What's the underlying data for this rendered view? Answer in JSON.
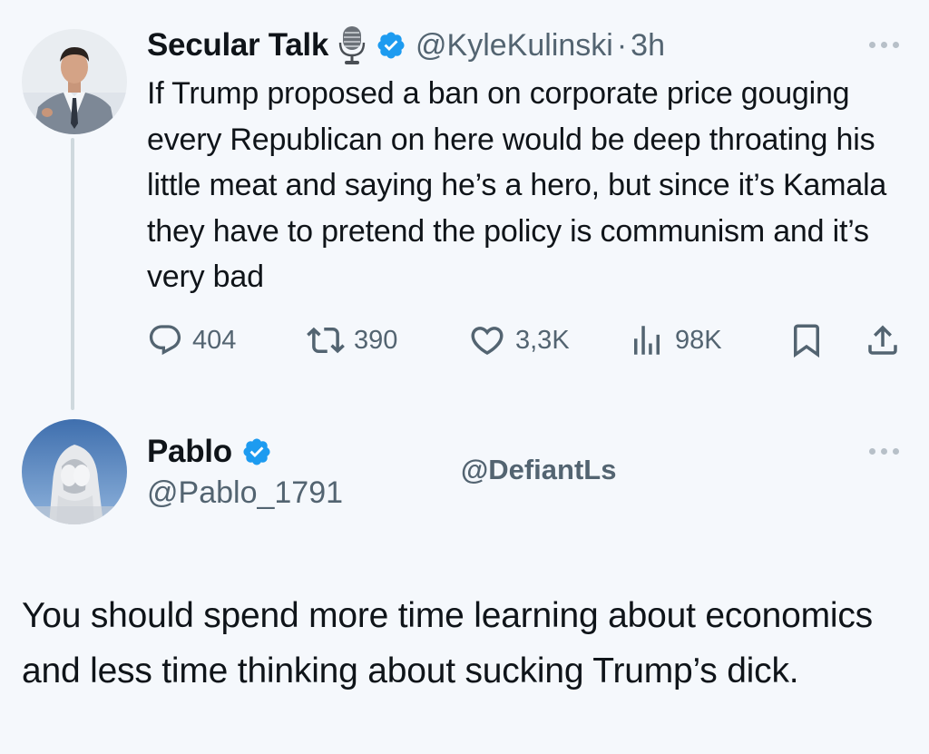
{
  "tweet": {
    "author_name": "Secular Talk",
    "author_handle": "@KyleKulinski",
    "separator": "·",
    "time": "3h",
    "text": "If Trump proposed a ban on corporate price gouging every Republican on here would be deep throating his little meat and saying he’s a hero, but since it’s Kamala they have to pretend the policy is communism and it’s very bad",
    "actions": {
      "replies": "404",
      "reposts": "390",
      "likes": "3,3K",
      "views": "98K"
    },
    "icons": [
      "microphone-icon",
      "verified-badge-icon",
      "more-icon",
      "reply-icon",
      "repost-icon",
      "like-icon",
      "views-icon",
      "bookmark-icon",
      "share-icon"
    ]
  },
  "reply": {
    "author_name": "Pablo",
    "author_handle": "@Pablo_1791",
    "mention": "@DefiantLs",
    "text": "You should spend more time learning about economics and less time thinking about sucking Trump’s dick."
  },
  "colors": {
    "background": "#f5f8fc",
    "text": "#0f1419",
    "secondary": "#536471",
    "verified": "#1d9bf0",
    "thread_line": "#cfd9de"
  }
}
